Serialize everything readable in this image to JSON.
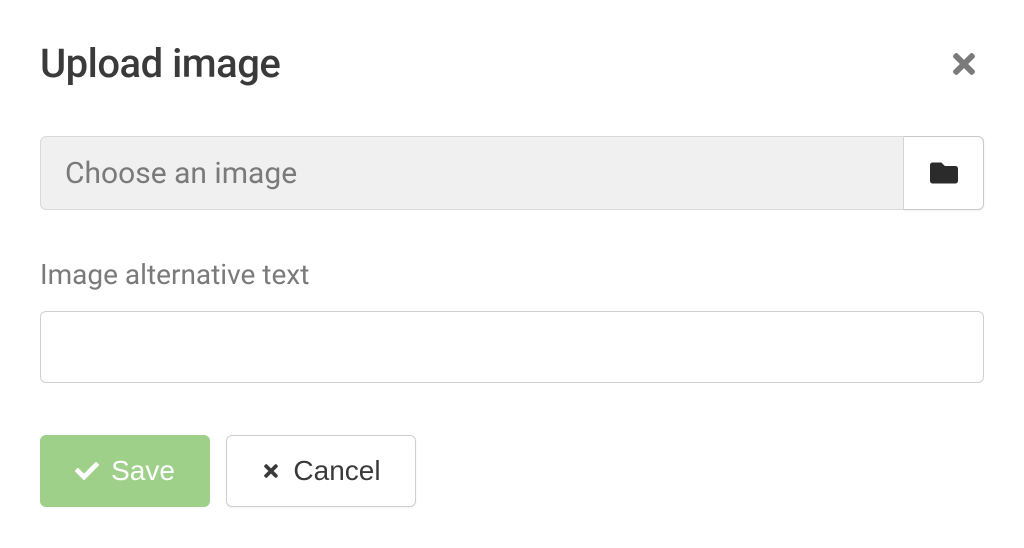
{
  "dialog": {
    "title": "Upload image",
    "file_placeholder": "Choose an image",
    "alt_text_label": "Image alternative text",
    "alt_text_value": "",
    "save_label": "Save",
    "cancel_label": "Cancel"
  },
  "icons": {
    "close": "close-icon",
    "folder": "folder-icon",
    "check": "check-icon",
    "times": "times-icon"
  },
  "colors": {
    "save_bg": "#9ed08a",
    "text_muted": "#7a7a7a",
    "text_main": "#3a3a3a",
    "input_bg": "#f0f0f0",
    "border": "#cfcfcf"
  }
}
